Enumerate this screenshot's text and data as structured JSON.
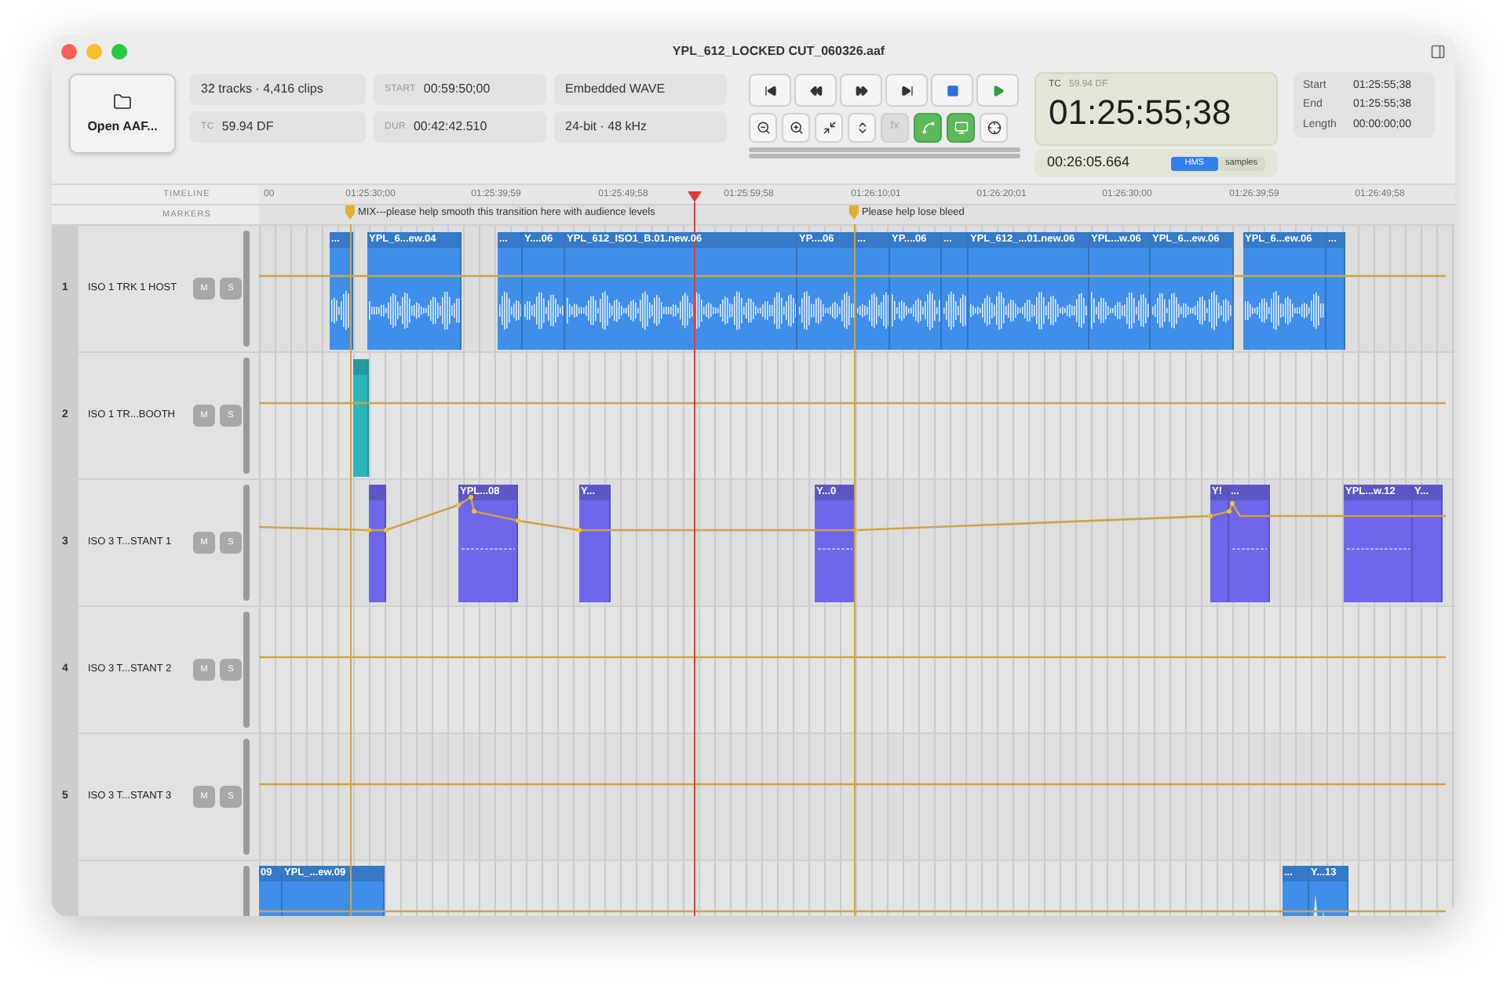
{
  "window": {
    "title": "YPL_612_LOCKED CUT_060326.aaf"
  },
  "toolbar": {
    "open_button": "Open AAF...",
    "info": [
      {
        "value": "32 tracks · 4,416 clips"
      },
      {
        "label": "START",
        "value": "00:59:50;00"
      },
      {
        "value": "Embedded WAVE"
      },
      {
        "label": "TC",
        "value": "59.94 DF"
      },
      {
        "label": "DUR",
        "value": "00:42:42.510"
      },
      {
        "value": "24-bit · 48 kHz"
      }
    ],
    "transport": [
      {
        "kind": "to-start"
      },
      {
        "kind": "rewind"
      },
      {
        "kind": "forward"
      },
      {
        "kind": "to-end"
      },
      {
        "kind": "stop"
      },
      {
        "kind": "play"
      }
    ],
    "tools": [
      {
        "kind": "zoom-out",
        "on": false
      },
      {
        "kind": "zoom-in",
        "on": false
      },
      {
        "kind": "fit",
        "on": false
      },
      {
        "kind": "height",
        "on": false
      },
      {
        "kind": "fx",
        "label": "fx",
        "on": false,
        "disabled": true
      },
      {
        "kind": "link",
        "on": true
      },
      {
        "kind": "monitor",
        "on": true
      },
      {
        "kind": "target",
        "on": false
      }
    ]
  },
  "timecode": {
    "label": "TC",
    "rate": "59.94 DF",
    "value": "01:25:55;38",
    "elapsed": "00:26:05.664",
    "modes": [
      {
        "label": "HMS",
        "selected": true
      },
      {
        "label": "samples",
        "selected": false
      }
    ]
  },
  "selection": [
    {
      "label": "Start",
      "value": "01:25:55;38"
    },
    {
      "label": "End",
      "value": "01:25:55;38"
    },
    {
      "label": "Length",
      "value": "00:00:00;00"
    }
  ],
  "ruler": {
    "timeline_label": "TIMELINE",
    "markers_label": "MARKERS",
    "ticks": [
      "00",
      "01:25:30;00",
      "01:25:39;59",
      "01:25:49;58",
      "01:25:59;58",
      "01:26:10;01",
      "01:26:20;01",
      "01:26:30;00",
      "01:26:39;59",
      "01:26:49;58"
    ]
  },
  "markers": [
    {
      "text": "MIX---please help smooth this transition here with audience levels",
      "color": "#e0b028"
    },
    {
      "text": "Please help lose bleed",
      "color": "#e0b028"
    }
  ],
  "tracks": [
    {
      "number": "1",
      "name": "ISO 1 TRK 1 HOST",
      "mute": "M",
      "solo": "S",
      "muted": false,
      "soloed": false,
      "color": "#3f8fea",
      "clips": [
        "...",
        "YPL_6...ew.04",
        "...",
        "Y....06",
        "YPL_612_ISO1_B.01.new.06",
        "YP....06",
        "...",
        "YP....06",
        "...",
        "YPL_612_...01.new.06",
        "YPL...w.06",
        "YPL_6...ew.06",
        "YPL_6...ew.06",
        "..."
      ]
    },
    {
      "number": "2",
      "name": "ISO 1 TR...BOOTH",
      "mute": "M",
      "solo": "S",
      "muted": false,
      "soloed": false,
      "color": "#2bb5bb"
    },
    {
      "number": "3",
      "name": "ISO 3 T...STANT 1",
      "mute": "M",
      "solo": "S",
      "muted": false,
      "soloed": false,
      "color": "#6e66ea",
      "clips": [
        "YPL...08",
        "Y...",
        "Y...0",
        "Y!",
        "...",
        "YPL...w.12",
        "Y..."
      ]
    },
    {
      "number": "4",
      "name": "ISO 3 T...STANT 2",
      "mute": "M",
      "solo": "S",
      "muted": false,
      "soloed": false
    },
    {
      "number": "5",
      "name": "ISO 3 T...STANT 3",
      "mute": "M",
      "solo": "S",
      "muted": false,
      "soloed": false
    },
    {
      "color": "#3f8fea",
      "clips": [
        "09",
        "YPL_...ew.09",
        "...",
        "Y...13"
      ]
    }
  ]
}
